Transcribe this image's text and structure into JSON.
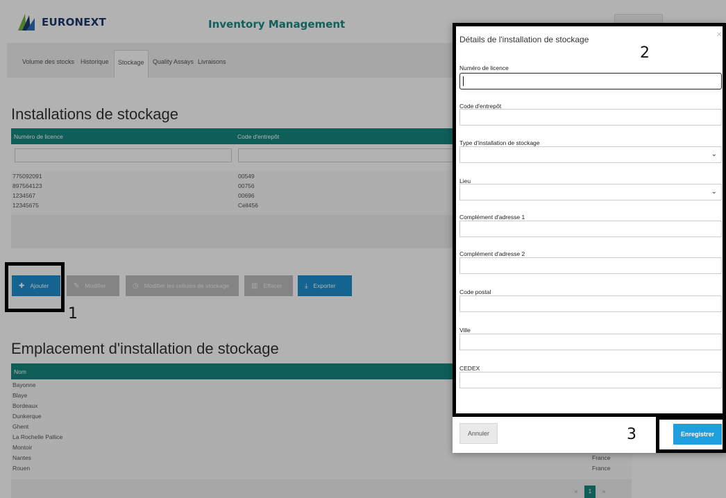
{
  "header": {
    "brand": "EURONEXT",
    "app_title": "Inventory Management"
  },
  "tabs": [
    {
      "label": "Volume des stocks",
      "active": false
    },
    {
      "label": "Historique",
      "active": false
    },
    {
      "label": "Stockage",
      "active": true
    },
    {
      "label": "Quality Assays",
      "active": false
    },
    {
      "label": "Livraisons",
      "active": false
    }
  ],
  "storage": {
    "title": "Installations de stockage",
    "columns": [
      "Numéro de licence",
      "Code d'entrepôt"
    ],
    "rows": [
      [
        "775092091",
        "00549"
      ],
      [
        "897564123",
        "00756"
      ],
      [
        "1234567",
        "00696"
      ],
      [
        "12345675",
        "Cell456"
      ]
    ]
  },
  "actions": {
    "add": "Ajouter",
    "edit": "Modifier",
    "edit_cells": "Modifier les cellules de stockage",
    "delete": "Effacer",
    "export": "Exporter"
  },
  "locations": {
    "title": "Emplacement d'installation de stockage",
    "column": "Nom",
    "rows": [
      {
        "name": "Bayonne",
        "country": ""
      },
      {
        "name": "Blaye",
        "country": ""
      },
      {
        "name": "Bordeaux",
        "country": ""
      },
      {
        "name": "Dunkerque",
        "country": ""
      },
      {
        "name": "Ghent",
        "country": ""
      },
      {
        "name": "La Rochelle Pallice",
        "country": ""
      },
      {
        "name": "Montoir",
        "country": ""
      },
      {
        "name": "Nantes",
        "country": "France"
      },
      {
        "name": "Rouen",
        "country": "France"
      }
    ],
    "pager": {
      "prev": "«",
      "current": "1",
      "next": "»"
    }
  },
  "modal": {
    "title": "Détails de l'installation de stockage",
    "fields": [
      {
        "label": "Numéro de licence",
        "value": "",
        "type": "text"
      },
      {
        "label": "Code d'entrepôt",
        "value": "",
        "type": "text"
      },
      {
        "label": "Type d'installation de stockage",
        "value": "",
        "type": "select"
      },
      {
        "label": "Lieu",
        "value": "",
        "type": "select"
      },
      {
        "label": "Complément d'adresse 1",
        "value": "",
        "type": "text"
      },
      {
        "label": "Complément d'adresse 2",
        "value": "",
        "type": "text"
      },
      {
        "label": "Code postal",
        "value": "",
        "type": "text"
      },
      {
        "label": "Ville",
        "value": "",
        "type": "text"
      },
      {
        "label": "CEDEX",
        "value": "",
        "type": "text"
      }
    ],
    "cancel": "Annuler",
    "save": "Enregistrer"
  },
  "annotations": [
    "1",
    "2",
    "3"
  ],
  "colors": {
    "teal": "#16897f",
    "primary_blue": "#1e8fd0",
    "save_blue": "#1e9fe0",
    "brand_navy": "#1c3a6e"
  }
}
